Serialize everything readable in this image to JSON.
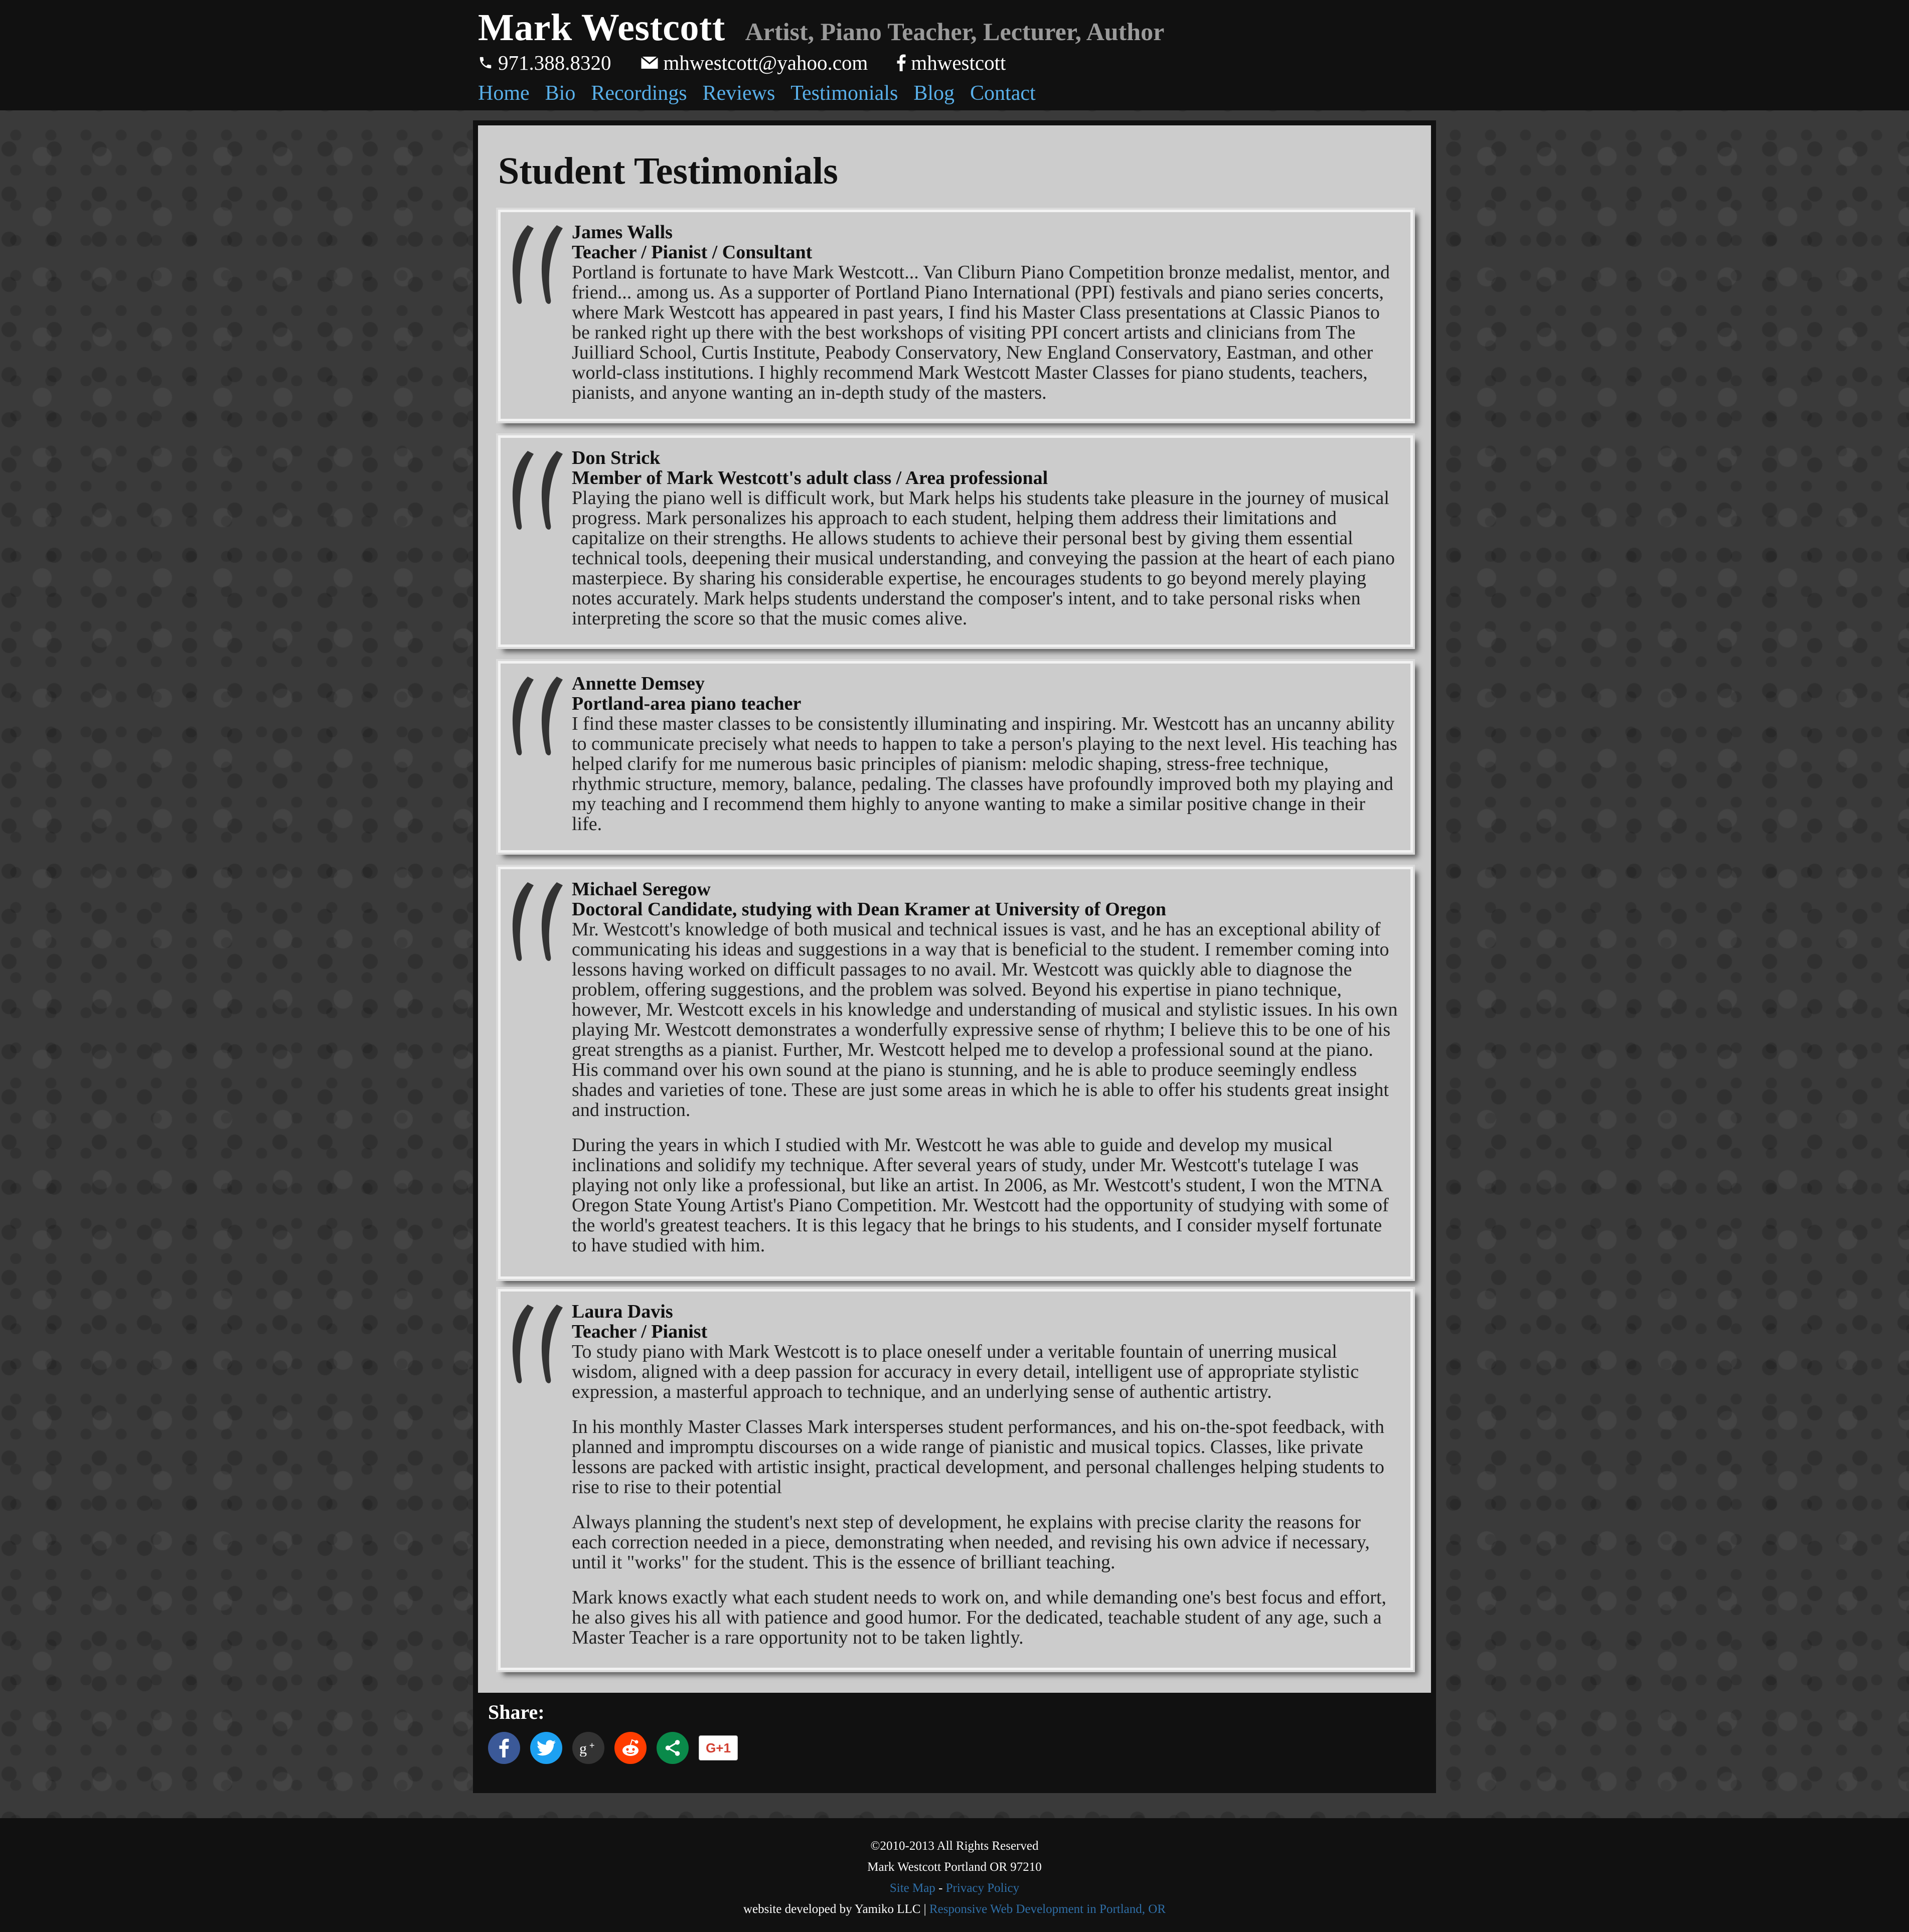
{
  "header": {
    "title": "Mark Westcott",
    "tagline": "Artist, Piano Teacher, Lecturer, Author",
    "phone": "971.388.8320",
    "email": "mhwestcott@yahoo.com",
    "facebook": "mhwestcott",
    "nav": [
      "Home",
      "Bio",
      "Recordings",
      "Reviews",
      "Testimonials",
      "Blog",
      "Contact"
    ]
  },
  "page_title": "Student Testimonials",
  "testimonials": [
    {
      "name": "James Walls",
      "role": "Teacher / Pianist / Consultant",
      "paragraphs": [
        "Portland is fortunate to have Mark Westcott... Van Cliburn Piano Competition bronze medalist, mentor, and friend... among us. As a supporter of Portland Piano International (PPI) festivals and piano series concerts, where Mark Westcott has appeared in past years, I find his Master Class presentations at Classic Pianos to be ranked right up there with the best workshops of visiting PPI concert artists and clinicians from The Juilliard School, Curtis Institute, Peabody Conservatory, New England Conservatory, Eastman, and other world-class institutions. I highly recommend Mark Westcott Master Classes for piano students, teachers, pianists, and anyone wanting an in-depth study of the masters."
      ]
    },
    {
      "name": "Don Strick",
      "role": "Member of Mark Westcott's adult class / Area professional",
      "paragraphs": [
        "Playing the piano well is difficult work, but Mark helps his students take pleasure in the journey of musical progress. Mark personalizes his approach to each student, helping them address their limitations and capitalize on their strengths. He allows students to achieve their personal best by giving them essential technical tools, deepening their musical understanding, and conveying the passion at the heart of each piano masterpiece. By sharing his considerable expertise, he encourages students to go beyond merely playing notes accurately. Mark helps students understand the composer's intent, and to take personal risks when interpreting the score so that the music comes alive."
      ]
    },
    {
      "name": "Annette Demsey",
      "role": "Portland-area piano teacher",
      "paragraphs": [
        "I find these master classes to be consistently illuminating and inspiring. Mr. Westcott has an uncanny ability to communicate precisely what needs to happen to take a person's playing to the next level. His teaching has helped clarify for me numerous basic principles of pianism: melodic shaping, stress-free technique, rhythmic structure, memory, balance, pedaling. The classes have profoundly improved both my playing and my teaching and I recommend them highly to anyone wanting to make a similar positive change in their life."
      ]
    },
    {
      "name": "Michael Seregow",
      "role": "Doctoral Candidate, studying with Dean Kramer at University of Oregon",
      "paragraphs": [
        "Mr. Westcott's knowledge of both musical and technical issues is vast, and he has an exceptional ability of communicating his ideas and suggestions in a way that is beneficial to the student. I remember coming into lessons having worked on difficult passages to no avail. Mr. Westcott was quickly able to diagnose the problem, offering suggestions, and the problem was solved. Beyond his expertise in piano technique, however, Mr. Westcott excels in his knowledge and understanding of musical and stylistic issues. In his own playing Mr. Westcott demonstrates a wonderfully expressive sense of rhythm; I believe this to be one of his great strengths as a pianist. Further, Mr. Westcott helped me to develop a professional sound at the piano. His command over his own sound at the piano is stunning, and he is able to produce seemingly endless shades and varieties of tone. These are just some areas in which he is able to offer his students great insight and instruction.",
        "During the years in which I studied with Mr. Westcott he was able to guide and develop my musical inclinations and solidify my technique. After several years of study, under Mr. Westcott's tutelage I was playing not only like a professional, but like an artist. In 2006, as Mr. Westcott's student, I won the MTNA Oregon State Young Artist's Piano Competition. Mr. Westcott had the opportunity of studying with some of the world's greatest teachers. It is this legacy that he brings to his students, and I consider myself fortunate to have studied with him."
      ]
    },
    {
      "name": "Laura Davis",
      "role": "Teacher / Pianist",
      "paragraphs": [
        "To study piano with Mark Westcott is to place oneself under a veritable fountain of unerring musical wisdom, aligned with a deep passion for accuracy in every detail, intelligent use of appropriate stylistic expression, a masterful approach to technique, and an underlying sense of authentic artistry.",
        "In his monthly Master Classes Mark intersperses student performances, and his on-the-spot feedback, with planned and impromptu discourses on a wide range of pianistic and musical topics. Classes, like private lessons are packed with artistic insight, practical development, and personal challenges helping students to rise to rise to their potential",
        "Always planning the student's next step of development, he explains with precise clarity the reasons for each correction needed in a piece, demonstrating when needed, and revising his own advice if necessary, until it \"works\" for the student. This is the essence of brilliant teaching.",
        "Mark knows exactly what each student needs to work on, and while demanding one's best focus and effort, he also gives his all with patience and good humor. For the dedicated, teachable student of any age, such a Master Teacher is a rare opportunity not to be taken lightly."
      ]
    }
  ],
  "share": {
    "label": "Share:",
    "icons": [
      "facebook-icon",
      "twitter-icon",
      "google-plus-icon",
      "reddit-icon",
      "share-icon",
      "google-plus-one-icon"
    ],
    "gplus_label": "G+1",
    "colors": {
      "facebook": "#3b5998",
      "twitter": "#1da1f2",
      "google_plus": "#333333",
      "reddit": "#ff3d00",
      "share": "#0a8a4a"
    }
  },
  "footer": {
    "copyright": "©2010-2013 All Rights Reserved",
    "address": "Mark Westcott Portland OR 97210",
    "site_map": "Site Map",
    "separator": "-",
    "privacy": "Privacy Policy",
    "dev_prefix": "website developed by Yamiko LLC |",
    "dev_link": "Responsive Web Development in Portland, OR"
  },
  "colors": {
    "nav_link": "#59b0ea",
    "header_bg": "#111111",
    "content_bg": "#cccccc",
    "footer_link": "#2f6fa8"
  }
}
